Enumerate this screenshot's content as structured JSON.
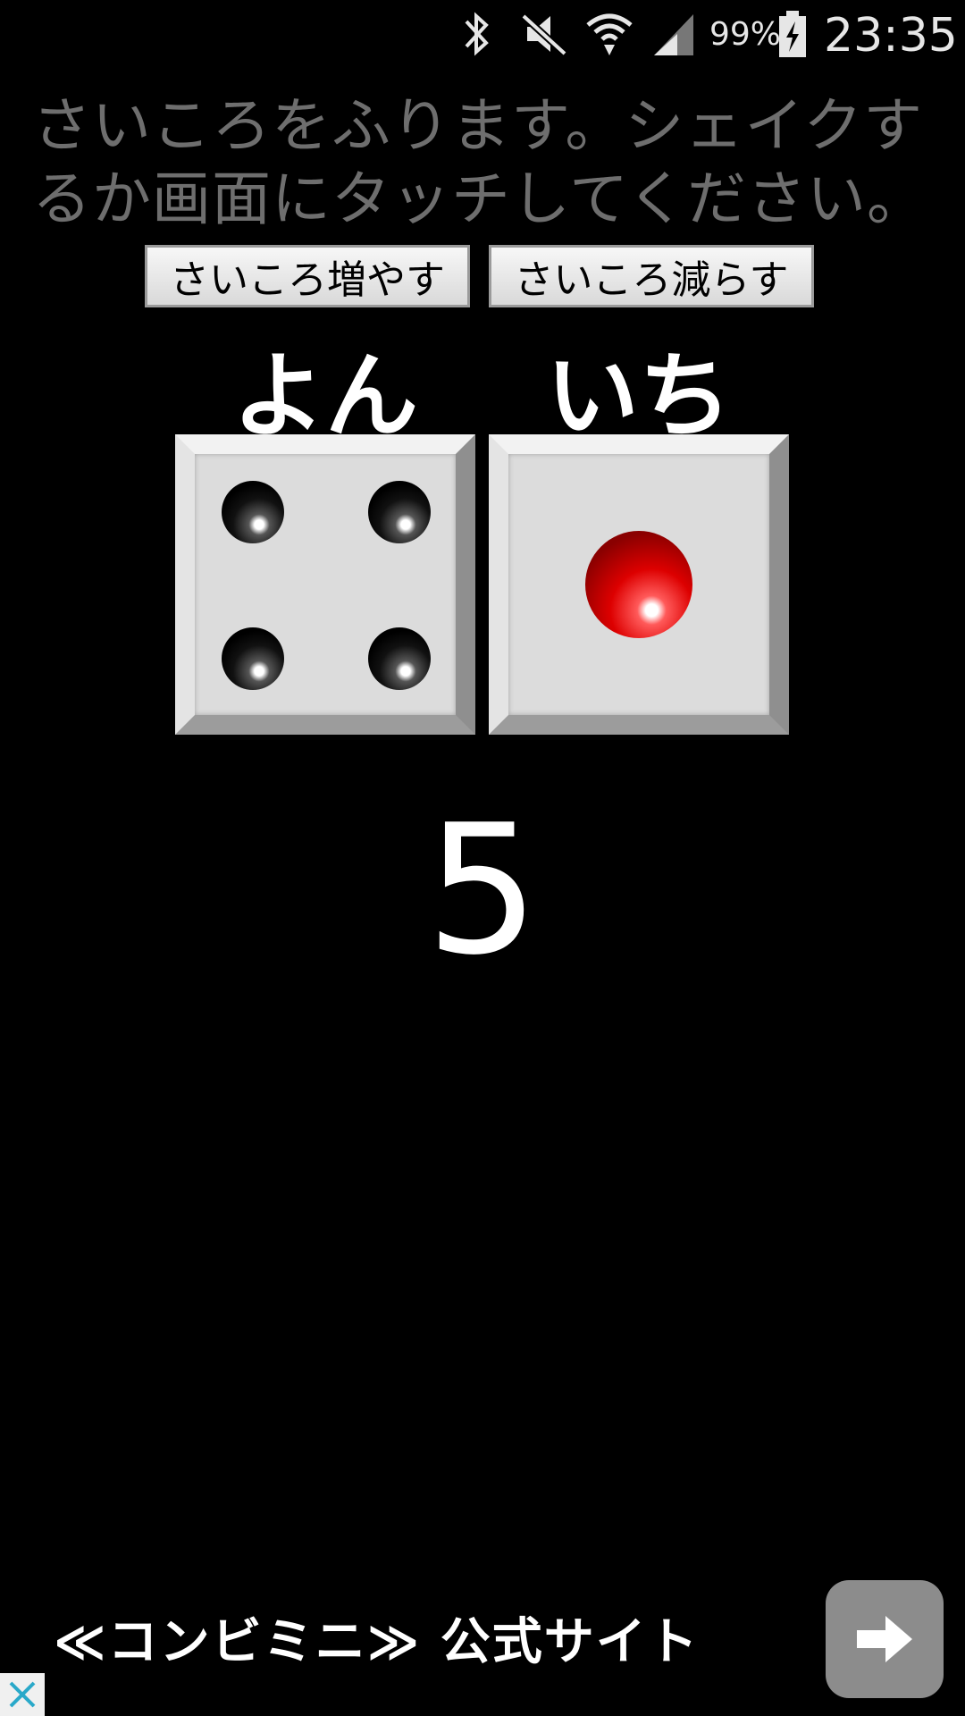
{
  "status_bar": {
    "battery_percent": "99%",
    "time": "23:35",
    "icons": [
      "bluetooth-icon",
      "mute-icon",
      "wifi-icon",
      "signal-icon",
      "battery-charging-icon"
    ]
  },
  "instruction": "さいころをふります。シェイクするか画面にタッチしてください。",
  "buttons": {
    "increase": "さいころ増やす",
    "decrease": "さいころ減らす"
  },
  "dice": [
    {
      "label": "よん",
      "value": 4
    },
    {
      "label": "いち",
      "value": 1
    }
  ],
  "total": "5",
  "ad": {
    "text": "≪コンビミニ≫ 公式サイト",
    "icons": [
      "arrow-right-icon",
      "close-icon"
    ]
  },
  "colors": {
    "background": "#000000",
    "instruction_text": "#6e6e6e",
    "pip_red": "#dd0000"
  }
}
